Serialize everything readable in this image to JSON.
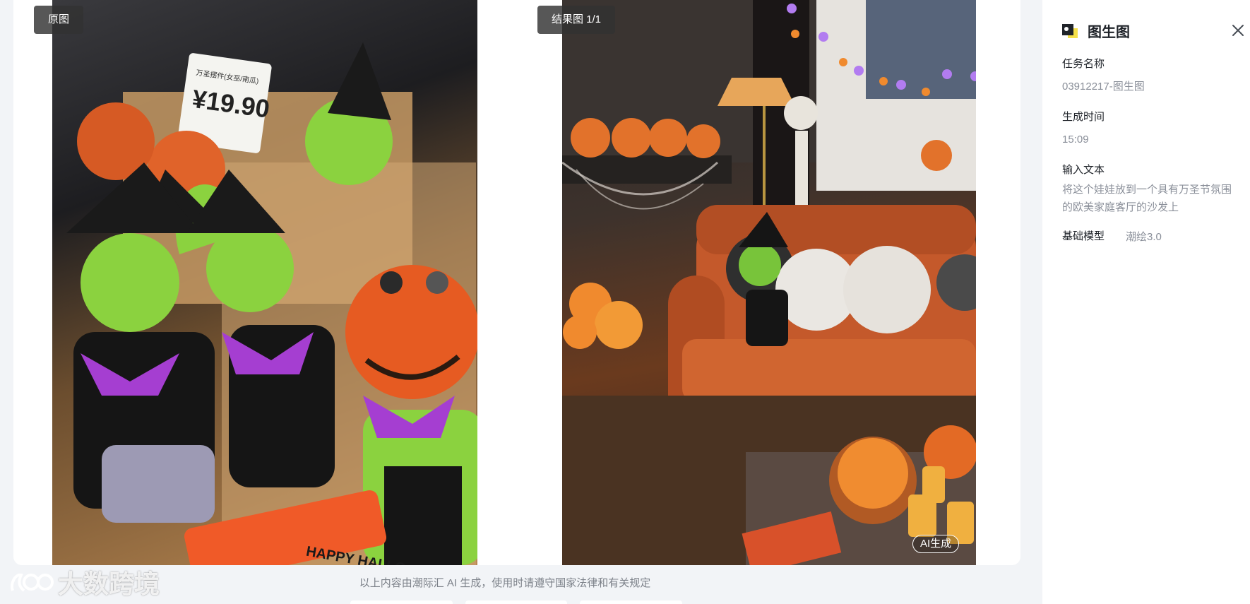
{
  "viewer": {
    "original_label": "原图",
    "result_label": "结果图 1/1",
    "ai_badge": "AI生成",
    "footer_note": "以上内容由潮际汇 AI 生成，使用时请遵守国家法律和有关规定",
    "watermark_text": "大数跨境",
    "original_image_text": {
      "price_tag_title": "万圣摆件(女巫/南瓜)",
      "price": "¥19.90",
      "banner": "HAPPY HALLO"
    }
  },
  "panel": {
    "title": "图生图",
    "task_name_label": "任务名称",
    "task_name_value": "03912217-图生图",
    "time_label": "生成时间",
    "time_value": "15:09",
    "prompt_label": "输入文本",
    "prompt_value": "将这个娃娃放到一个具有万圣节氛围的欧美家庭客厅的沙发上",
    "model_label": "基础模型",
    "model_value": "潮绘3.0"
  },
  "icons": {
    "app_icon": "image-to-image-icon",
    "close_icon": "close-icon",
    "watermark_logo": "brand-logo-icon"
  },
  "colors": {
    "background": "#f2f4f7",
    "panel_bg": "#ffffff",
    "label_pill_bg": "#323232",
    "muted_text": "#8a8f99",
    "accent_yellow": "#f5e04a"
  }
}
